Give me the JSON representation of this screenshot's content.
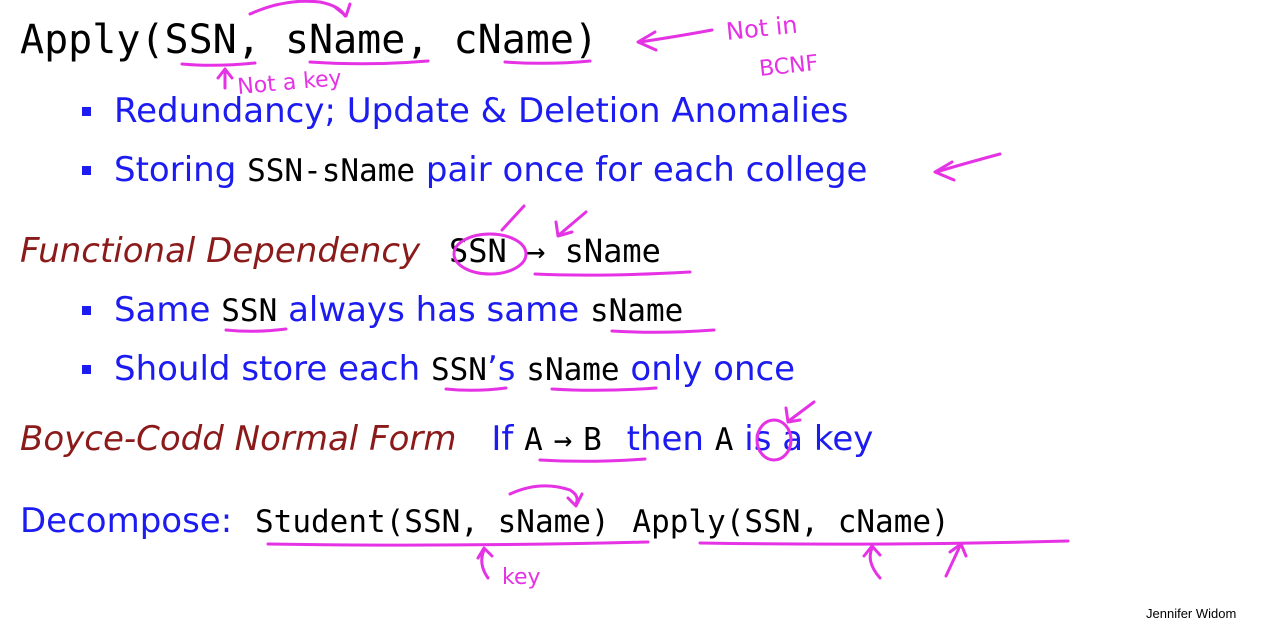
{
  "schema_line": {
    "relation": "Apply",
    "open": "(",
    "attr1": "SSN",
    "sep1": ", ",
    "attr2": "sName",
    "sep2": ", ",
    "attr3": "cName",
    "close": ")"
  },
  "problems": [
    {
      "text": "Redundancy; Update & Deletion Anomalies"
    },
    {
      "prefix": "Storing ",
      "code": "SSN-sName",
      "suffix": " pair once for each college"
    }
  ],
  "fd": {
    "label": "Functional Dependency",
    "lhs": "SSN",
    "arrow": "→",
    "rhs": "sName"
  },
  "fd_points": [
    {
      "prefix": "Same ",
      "code1": "SSN",
      "middle": " always has same ",
      "code2": "sName"
    },
    {
      "prefix": "Should store each ",
      "code1": "SSN",
      "middle": "’s ",
      "code2": "sName",
      "suffix": " only once"
    }
  ],
  "bcnf": {
    "label": "Boyce-Codd Normal Form",
    "if_text": "If",
    "lhs": "A",
    "arrow": "→",
    "rhs": "B",
    "then_text": "then",
    "key_attr": "A",
    "key_text": "is a key"
  },
  "decompose": {
    "label": "Decompose:",
    "rel1": "Student(SSN, sName)",
    "rel2": "Apply(SSN, cName)"
  },
  "footer": {
    "author": "Jennifer Widom"
  },
  "handwriting": {
    "not_a_key": "Not a key",
    "not_in": "Not in",
    "bcnf": "BCNF",
    "key": "key"
  },
  "colors": {
    "text_blue": "#1c1cf0",
    "heading_maroon": "#8b1a1a",
    "ink_magenta": "#e532e5"
  }
}
